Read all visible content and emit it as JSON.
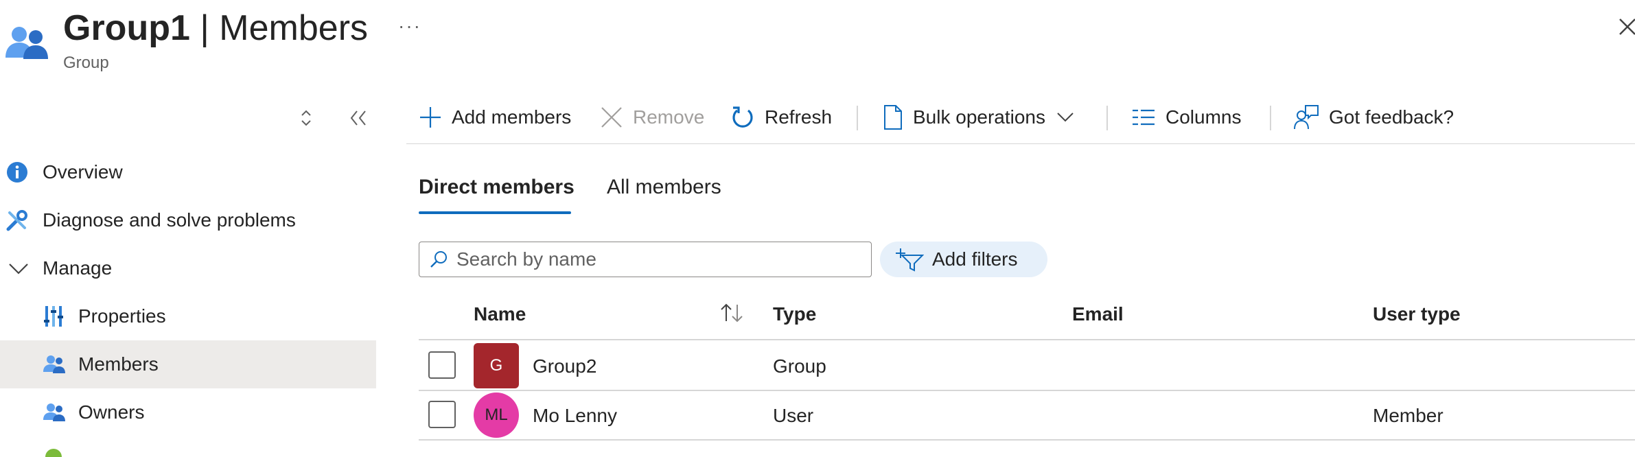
{
  "header": {
    "title_bold": "Group1",
    "title_rest": " | Members",
    "subtitle": "Group",
    "more": "···"
  },
  "nav": {
    "items": [
      {
        "label": "Overview",
        "icon": "info-icon"
      },
      {
        "label": "Diagnose and solve problems",
        "icon": "wrench-icon"
      },
      {
        "label": "Manage",
        "icon": "chevron-down-icon"
      },
      {
        "label": "Properties",
        "icon": "properties-icon"
      },
      {
        "label": "Members",
        "icon": "people-icon",
        "selected": true
      },
      {
        "label": "Owners",
        "icon": "people-icon"
      }
    ]
  },
  "toolbar": {
    "add_members": "Add members",
    "remove": "Remove",
    "refresh": "Refresh",
    "bulk_operations": "Bulk operations",
    "columns": "Columns",
    "feedback": "Got feedback?"
  },
  "tabs": [
    {
      "label": "Direct members",
      "active": true
    },
    {
      "label": "All members",
      "active": false
    }
  ],
  "search": {
    "placeholder": "Search by name",
    "value": ""
  },
  "filters": {
    "add_label": "Add filters"
  },
  "table": {
    "columns": [
      "Name",
      "Type",
      "Email",
      "User type"
    ],
    "rows": [
      {
        "initials": "G",
        "avatar_color": "#a4262c",
        "name": "Group2",
        "type": "Group",
        "email": "",
        "user_type": ""
      },
      {
        "initials": "ML",
        "avatar_color": "#e43ba6",
        "name": "Mo Lenny",
        "type": "User",
        "email": "",
        "user_type": "Member"
      }
    ]
  },
  "colors": {
    "accent": "#0f6cbd",
    "selected_nav": "#edebe9",
    "filter_bg": "#e6f0fa"
  }
}
